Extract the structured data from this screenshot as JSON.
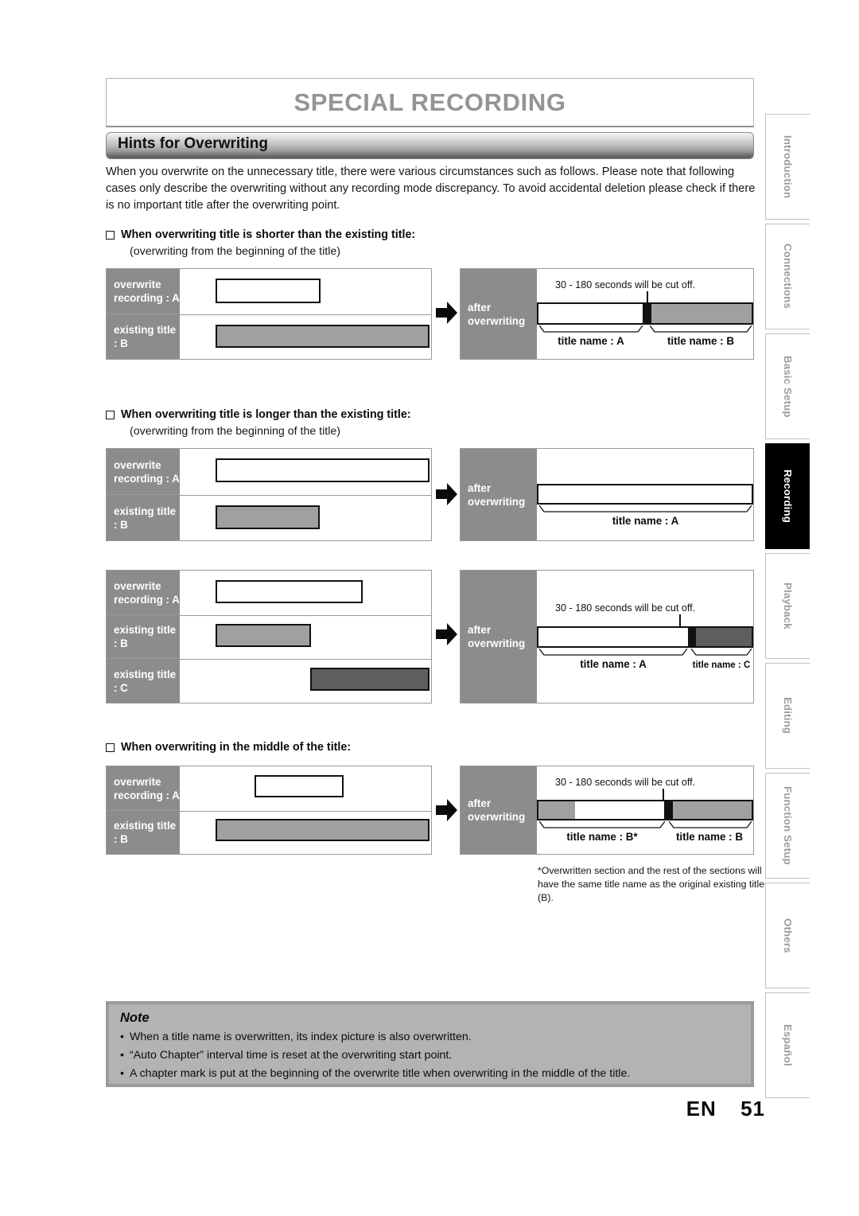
{
  "page": {
    "title": "SPECIAL RECORDING",
    "section": "Hints for Overwriting",
    "intro": "When you overwrite on the unnecessary title, there were various circumstances such as follows.  Please note that following cases only describe the overwriting without any recording mode discrepancy.  To avoid accidental deletion please check if there is no important title after the overwriting point.",
    "footer_lang": "EN",
    "footer_page": "51"
  },
  "labels": {
    "overwrite_recording_a": "overwrite\nrecording : A",
    "overwrite_line1": "overwrite",
    "overwrite_line2": "recording : A",
    "existing_b": "existing title : B",
    "existing_c": "existing title : C",
    "after_line1": "after",
    "after_line2": "overwriting",
    "cutoff": "30 - 180 seconds will be cut off.",
    "title_a": "title name : A",
    "title_b": "title name : B",
    "title_c": "title name : C",
    "title_b_star": "title name : B*"
  },
  "cases": [
    {
      "heading": "When overwriting title is shorter than the existing title:",
      "sub": "(overwriting from the beginning of the title)"
    },
    {
      "heading": "When overwriting title is longer than the existing title:",
      "sub": "(overwriting from the beginning of the title)"
    },
    {
      "heading": "When overwriting in the middle of the title:",
      "sub": ""
    }
  ],
  "footnote": "*Overwritten section and the rest of the sections will have the same title name as the original existing title (B).",
  "note": {
    "title": "Note",
    "items": [
      "When a title name is overwritten, its index picture is also overwritten.",
      "“Auto Chapter” interval time is reset at the overwriting start point.",
      "A chapter mark is put at the beginning of the overwrite title when overwriting in the middle of the title."
    ]
  },
  "tabs": [
    {
      "label": "Introduction",
      "active": false
    },
    {
      "label": "Connections",
      "active": false
    },
    {
      "label": "Basic Setup",
      "active": false
    },
    {
      "label": "Recording",
      "active": true
    },
    {
      "label": "Playback",
      "active": false
    },
    {
      "label": "Editing",
      "active": false
    },
    {
      "label": "Function Setup",
      "active": false
    },
    {
      "label": "Others",
      "active": false
    },
    {
      "label": "Español",
      "active": false
    }
  ],
  "colors": {
    "label_gray": "#8c8c8c",
    "bar_b_gray": "#a0a0a0",
    "bar_c_gray": "#5e5e5e",
    "note_bg": "#b3b3b3",
    "title_text": "#949494",
    "active_tab_bg": "#000000"
  },
  "chart_data": {
    "type": "timeline-bars",
    "diagrams": [
      {
        "id": "case1-before",
        "caption": "overwrite recording A shorter than existing title B",
        "rows": [
          {
            "label": "overwrite recording : A",
            "bar_start_pct": 0,
            "bar_width_pct": 37,
            "fill": "white"
          },
          {
            "label": "existing title : B",
            "bar_start_pct": 0,
            "bar_width_pct": 100,
            "fill": "gray-b"
          }
        ]
      },
      {
        "id": "case1-after",
        "caption": "after overwriting",
        "annotation": "30 - 180 seconds will be cut off.",
        "segments": [
          {
            "fill": "white",
            "width_pct": 49,
            "title": "title name : A"
          },
          {
            "fill": "black",
            "width_pct": 3,
            "title": ""
          },
          {
            "fill": "gray-b",
            "width_pct": 48,
            "title": "title name : B"
          }
        ]
      },
      {
        "id": "case2-before",
        "caption": "overwrite recording A longer than existing title B",
        "rows": [
          {
            "label": "overwrite recording : A",
            "bar_start_pct": 0,
            "bar_width_pct": 100,
            "fill": "white"
          },
          {
            "label": "existing title : B",
            "bar_start_pct": 0,
            "bar_width_pct": 36,
            "fill": "gray-b"
          }
        ]
      },
      {
        "id": "case2-after",
        "caption": "after overwriting",
        "segments": [
          {
            "fill": "white",
            "width_pct": 100,
            "title": "title name : A"
          }
        ]
      },
      {
        "id": "case3-before",
        "caption": "overwrite recording A over titles B and C",
        "rows": [
          {
            "label": "overwrite recording : A",
            "bar_start_pct": 0,
            "bar_width_pct": 66,
            "fill": "white"
          },
          {
            "label": "existing title : B",
            "bar_start_pct": 0,
            "bar_width_pct": 45,
            "fill": "gray-b"
          },
          {
            "label": "existing title : C",
            "bar_start_pct": 45,
            "bar_width_pct": 55,
            "fill": "gray-c"
          }
        ]
      },
      {
        "id": "case3-after",
        "caption": "after overwriting",
        "annotation": "30 - 180 seconds will be cut off.",
        "segments": [
          {
            "fill": "white",
            "width_pct": 70,
            "title": "title name : A"
          },
          {
            "fill": "black",
            "width_pct": 3,
            "title": ""
          },
          {
            "fill": "gray-c",
            "width_pct": 27,
            "title": "title name : C"
          }
        ]
      },
      {
        "id": "case4-before",
        "caption": "overwrite recording A in the middle of title B",
        "rows": [
          {
            "label": "overwrite recording : A",
            "bar_start_pct": 18,
            "bar_width_pct": 31,
            "fill": "white"
          },
          {
            "label": "existing title : B",
            "bar_start_pct": 0,
            "bar_width_pct": 100,
            "fill": "gray-b"
          }
        ]
      },
      {
        "id": "case4-after",
        "caption": "after overwriting",
        "annotation": "30 - 180 seconds will be cut off.",
        "segments": [
          {
            "fill": "gray-b",
            "width_pct": 18,
            "title": ""
          },
          {
            "fill": "white",
            "width_pct": 42,
            "title": "title name : B*"
          },
          {
            "fill": "black",
            "width_pct": 3,
            "title": ""
          },
          {
            "fill": "gray-b",
            "width_pct": 37,
            "title": "title name : B"
          }
        ]
      }
    ]
  }
}
